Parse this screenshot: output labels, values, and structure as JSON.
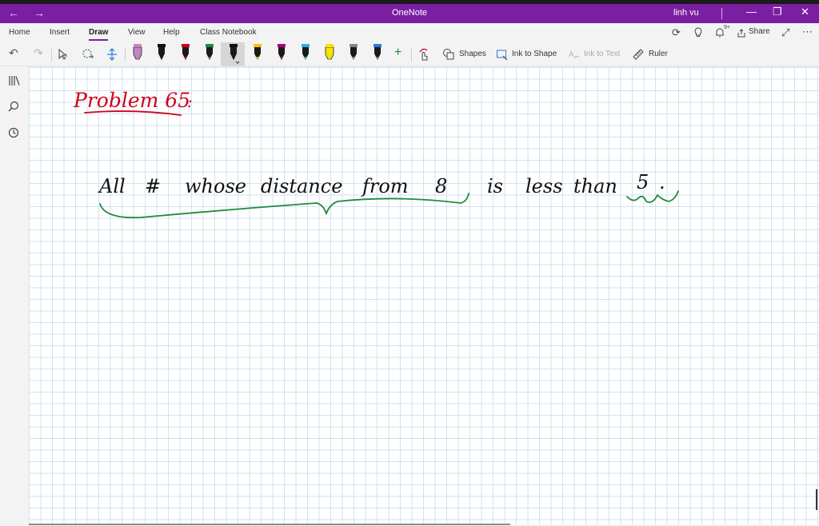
{
  "titlebar": {
    "back_icon": "←",
    "forward_icon": "→",
    "app_title": "OneNote",
    "user_name": "linh vu",
    "minimize_icon": "—",
    "restore_icon": "❐",
    "close_icon": "✕"
  },
  "ribbon": {
    "tabs": [
      "Home",
      "Insert",
      "Draw",
      "View",
      "Help",
      "Class Notebook"
    ],
    "active_tab": "Draw",
    "share_label": "Share",
    "notification_badge": "9+",
    "more_icon": "⋯"
  },
  "toolbar": {
    "shapes_label": "Shapes",
    "ink_to_shape_label": "Ink to Shape",
    "ink_to_text_label": "Ink to Text",
    "ruler_label": "Ruler",
    "add_pen_icon": "+",
    "pens": [
      {
        "color": "#c586c0",
        "type": "highlighter"
      },
      {
        "color": "#111111",
        "type": "pen"
      },
      {
        "color": "#d0021b",
        "type": "pen"
      },
      {
        "color": "#1f8a3a",
        "type": "pen"
      },
      {
        "color": "#111111",
        "type": "pen-selected"
      },
      {
        "color": "#f5c400",
        "type": "pen"
      },
      {
        "color": "#b0007a",
        "type": "pen"
      },
      {
        "color": "#2ab0e0",
        "type": "pen"
      },
      {
        "color": "#f5e400",
        "type": "highlighter"
      },
      {
        "color": "#888888",
        "type": "pencil"
      },
      {
        "color": "#2a7bd5",
        "type": "pen"
      }
    ]
  },
  "page": {
    "heading": "Problem 65",
    "heading_suffix": ":",
    "statement": [
      "All",
      "#",
      "whose",
      "distance",
      "from",
      "8",
      "is",
      "less",
      "than",
      "5",
      "."
    ]
  },
  "colors": {
    "accent": "#7b1fa2",
    "ink_red": "#d0021b",
    "ink_black": "#111111",
    "ink_green": "#1f8a3a",
    "grid": "#cfe3ee"
  }
}
